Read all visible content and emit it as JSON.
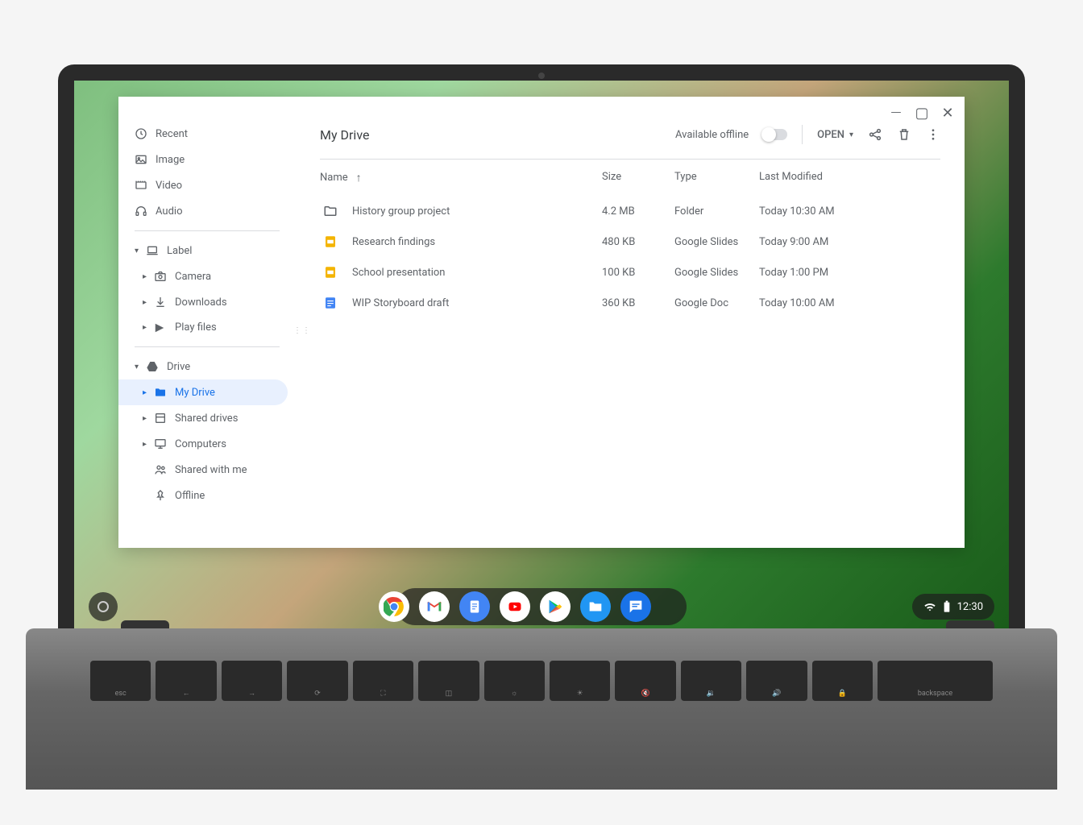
{
  "window": {
    "title": "My Drive"
  },
  "sidebar": {
    "quick": [
      {
        "label": "Recent",
        "icon": "clock"
      },
      {
        "label": "Image",
        "icon": "image"
      },
      {
        "label": "Video",
        "icon": "video"
      },
      {
        "label": "Audio",
        "icon": "audio"
      }
    ],
    "label_section": {
      "header": "Label",
      "items": [
        {
          "label": "Camera",
          "icon": "camera"
        },
        {
          "label": "Downloads",
          "icon": "download"
        },
        {
          "label": "Play files",
          "icon": "play"
        }
      ]
    },
    "drive_section": {
      "header": "Drive",
      "items": [
        {
          "label": "My Drive",
          "icon": "drive-folder",
          "selected": true
        },
        {
          "label": "Shared drives",
          "icon": "shared-drive"
        },
        {
          "label": "Computers",
          "icon": "computer"
        },
        {
          "label": "Shared with me",
          "icon": "people"
        },
        {
          "label": "Offline",
          "icon": "pin"
        }
      ]
    }
  },
  "toolbar": {
    "offline_label": "Available offline",
    "open_label": "OPEN"
  },
  "table": {
    "headers": {
      "name": "Name",
      "size": "Size",
      "type": "Type",
      "modified": "Last Modified"
    },
    "rows": [
      {
        "name": "History group project",
        "size": "4.2 MB",
        "type": "Folder",
        "modified": "Today 10:30 AM",
        "icon": "folder"
      },
      {
        "name": "Research findings",
        "size": "480 KB",
        "type": "Google Slides",
        "modified": "Today 9:00 AM",
        "icon": "slides"
      },
      {
        "name": "School presentation",
        "size": "100 KB",
        "type": "Google Slides",
        "modified": "Today 1:00 PM",
        "icon": "slides"
      },
      {
        "name": "WIP Storyboard draft",
        "size": "360 KB",
        "type": "Google Doc",
        "modified": "Today 10:00 AM",
        "icon": "doc"
      }
    ]
  },
  "shelf": {
    "apps": [
      "chrome",
      "gmail",
      "docs",
      "youtube",
      "play-store",
      "files",
      "messages"
    ]
  },
  "status": {
    "time": "12:30"
  }
}
